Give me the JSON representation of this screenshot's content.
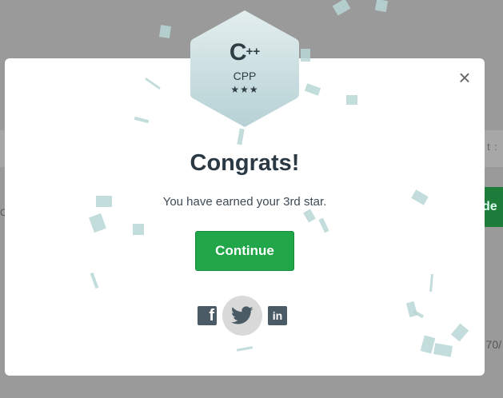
{
  "background": {
    "right_text": "t :",
    "green_button_text": "de",
    "left_text": "O",
    "right_number": "70/"
  },
  "modal": {
    "close_label": "×",
    "badge": {
      "logo_main": "C",
      "logo_plus": "++",
      "label": "CPP",
      "stars": "★★★"
    },
    "title": "Congrats!",
    "subtitle": "You have earned your 3rd star.",
    "continue_label": "Continue",
    "share": {
      "facebook_label": "f",
      "linkedin_label": "in"
    }
  },
  "colors": {
    "accent_green": "#21a64a",
    "badge_top": "#dfeaea",
    "badge_bottom": "#b8d3d6",
    "overlay": "#8f8f8f"
  }
}
